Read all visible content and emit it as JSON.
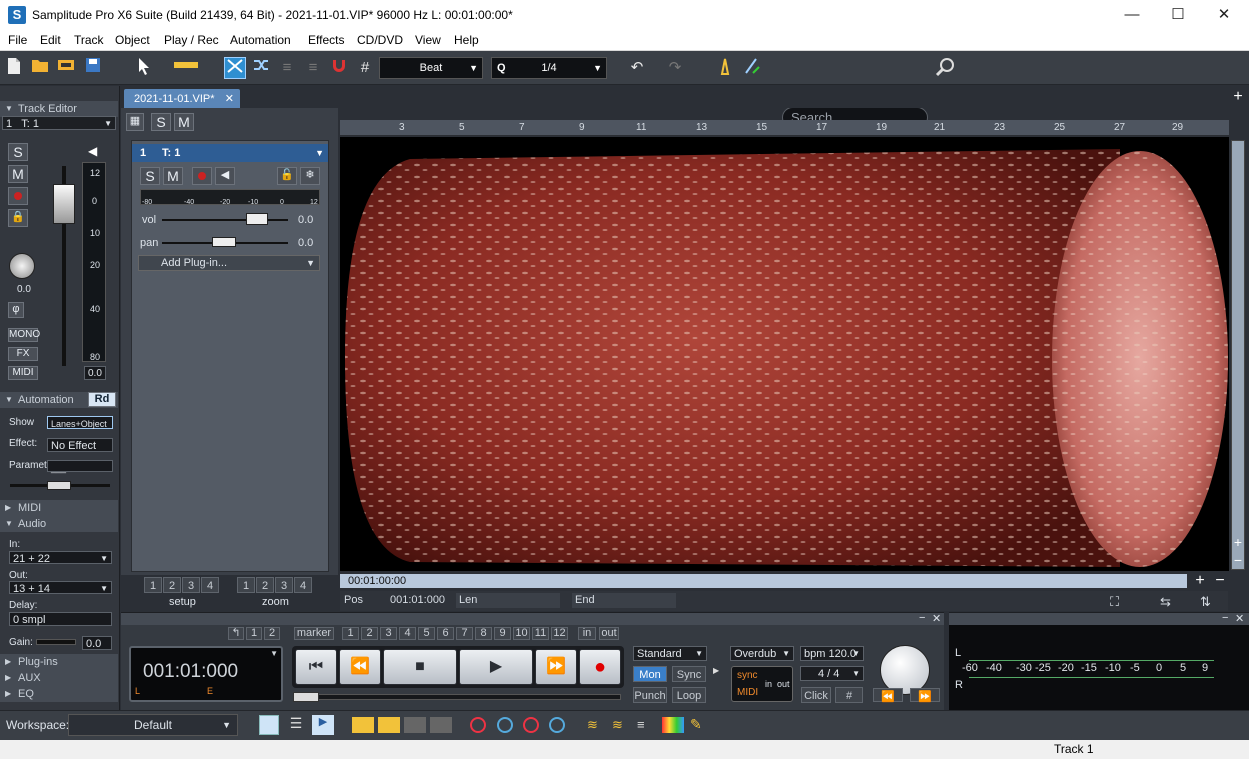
{
  "window": {
    "title": "Samplitude Pro X6 Suite (Build 21439, 64 Bit)  -  2021-11-01.VIP*   96000 Hz L: 00:01:00:00*",
    "logo": "S"
  },
  "window_controls": {
    "minimize": "—",
    "maximize": "☐",
    "close": "✕"
  },
  "menu": [
    "File",
    "Edit",
    "Track",
    "Object",
    "Play / Rec",
    "Automation",
    "Effects",
    "CD/DVD",
    "View",
    "Help"
  ],
  "toolbar": {
    "grid_mode": "Beat",
    "quantize_label": "Q",
    "quantize_value": "1/4",
    "search_placeholder": "Search"
  },
  "track_editor": {
    "header": "Track Editor",
    "track_no": "1",
    "track_name": "T: 1",
    "solo": "S",
    "mute": "M",
    "pan_value": "0.0",
    "vol_value": "0.0",
    "meter_scale": [
      "12",
      "0",
      "10",
      "20",
      "40",
      "80"
    ],
    "phase": "φ",
    "mono": "MONO",
    "fx": "FX",
    "midi": "MIDI"
  },
  "automation": {
    "header": "Automation",
    "mode": "Rd",
    "show_label": "Show",
    "show_value": "Lanes+Object",
    "effect_label": "Effect:",
    "effect_value": "No Effect",
    "parameter_label": "Parameter",
    "parameter_value": "___"
  },
  "sections": {
    "midi": "MIDI",
    "audio": "Audio",
    "plugins": "Plug-ins",
    "aux": "AUX",
    "eq": "EQ"
  },
  "audio": {
    "in_label": "In:",
    "in_value": "21 + 22",
    "out_label": "Out:",
    "out_value": "13 + 14",
    "delay_label": "Delay:",
    "delay_value": "0 smpl",
    "gain_label": "Gain:",
    "gain_value": "0.0"
  },
  "project_tab": {
    "name": "2021-11-01.VIP*",
    "close": "✕"
  },
  "track_header": {
    "s": "S",
    "m": "M",
    "number": "1",
    "name": "T: 1",
    "vol_label": "vol",
    "vol_value": "0.0",
    "pan_label": "pan",
    "pan_value": "0.0",
    "plugin": "Add Plug-in...",
    "meter_scale": [
      "-80",
      "-40",
      "-20",
      "-10",
      "0",
      "12"
    ],
    "setup_nums": [
      "1",
      "2",
      "3",
      "4"
    ],
    "setup_label": "setup",
    "zoom_nums": [
      "1",
      "2",
      "3",
      "4"
    ],
    "zoom_label": "zoom"
  },
  "ruler": [
    "3",
    "5",
    "7",
    "9",
    "11",
    "13",
    "15",
    "17",
    "19",
    "21",
    "23",
    "25",
    "27",
    "29"
  ],
  "position": {
    "time": "00:01:00:00",
    "pos_label": "Pos",
    "pos_value": "001:01:000",
    "len_label": "Len",
    "end_label": "End"
  },
  "transport": {
    "display": "001:01:000",
    "display_l": "L",
    "display_e": "E",
    "marker_label": "marker",
    "left_nums": [
      "1",
      "2"
    ],
    "marker_nums": [
      "1",
      "2",
      "3",
      "4",
      "5",
      "6",
      "7",
      "8",
      "9",
      "10",
      "11",
      "12"
    ],
    "in_label": "in",
    "out_label": "out",
    "mode": "Standard",
    "mon": "Mon",
    "sync": "Sync",
    "punch": "Punch",
    "loop": "Loop",
    "record_mode": "Overdub",
    "bpm": "bpm 120.0",
    "signature": "4 / 4",
    "sync_label": "sync",
    "midi_label": "MIDI",
    "in_small": "in",
    "out_small": "out",
    "click": "Click"
  },
  "meter": {
    "scale": [
      "-60",
      "-40",
      "-30",
      "-25",
      "-20",
      "-15",
      "-10",
      "-5",
      "0",
      "5",
      "9"
    ],
    "left": "L",
    "right": "R"
  },
  "workspace": {
    "label": "Workspace:",
    "value": "Default"
  },
  "status": {
    "track": "Track 1"
  },
  "colors": {
    "accent": "#5a86b8",
    "record": "#e00000",
    "selected_tool": "#2f8fd1"
  }
}
